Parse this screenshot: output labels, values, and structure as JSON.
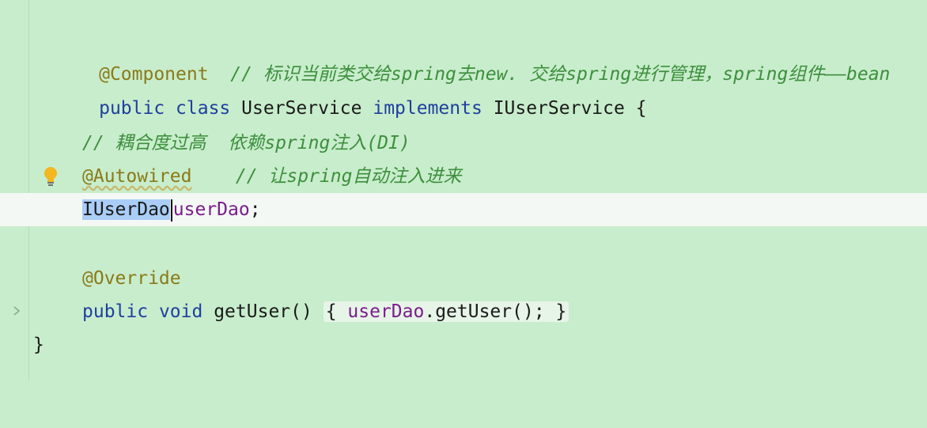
{
  "editor": {
    "lines": [
      {
        "annotation": "@Component",
        "comment": "// 标识当前类交给spring去new. 交给spring进行管理，spring组件——bean"
      },
      {
        "kw1": "public",
        "kw2": "class",
        "name": "UserService",
        "kw3": "implements",
        "iface": "IUserService",
        "brace": "{"
      },
      {},
      {
        "comment": "// 耦合度过高  依赖spring注入(DI)"
      },
      {
        "annotation": "@Autowired",
        "comment": "// 让spring自动注入进来"
      },
      {
        "type": "IUserDao",
        "field": "userDao",
        "semi": ";"
      },
      {},
      {
        "annotation": "@Override"
      },
      {
        "kw1": "public",
        "kw2": "void",
        "method": "getUser()",
        "open": "{",
        "body_field": "userDao",
        "body_call": ".getUser();",
        "close": "}"
      },
      {
        "brace": "}"
      }
    ]
  },
  "icons": {
    "bulb": "lightbulb-icon",
    "fold": "chevron-right-icon"
  },
  "colors": {
    "background": "#c8edcc",
    "current_line": "#f4f8f4",
    "keyword": "#1f3f9f",
    "annotation": "#8a7a1a",
    "comment": "#3d8f3d",
    "field": "#7a1d8c",
    "selection": "#a9cdf6"
  }
}
